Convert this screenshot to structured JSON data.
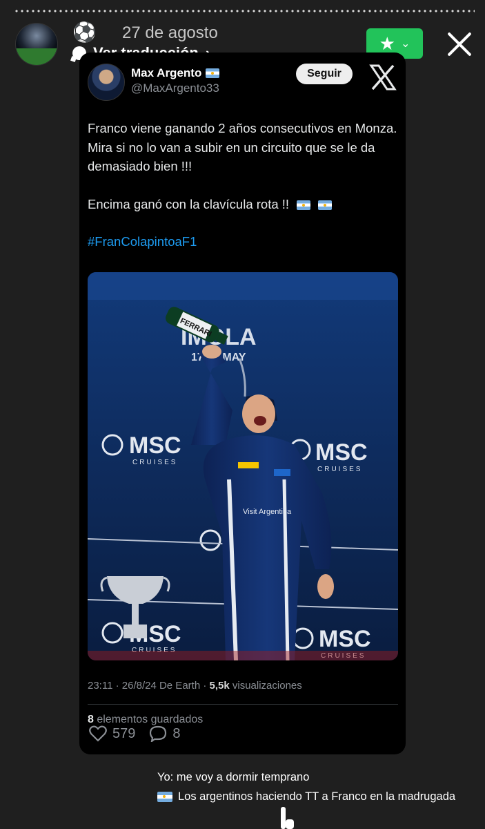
{
  "story": {
    "date": "27 de agosto",
    "ball_emoji": "⚽",
    "translate_label": "Ver traducción",
    "translate_chevron": "›",
    "favorite_star": "★",
    "favorite_caret": "⌄"
  },
  "tweet": {
    "name": "Max Argento",
    "handle": "@MaxArgento33",
    "follow_label": "Seguir",
    "text_line1": "Franco viene ganando 2 años consecutivos en Monza. Mira si no lo van a subir en un circuito que se le da demasiado bien !!!",
    "text_line2": "Encima ganó con la clavícula rota !!",
    "hashtag": "#FranColapintoaF1",
    "time_date": "23:11 · 26/8/24 De Earth · ",
    "views_count": "5,5k",
    "views_label": " visualizaciones",
    "saved_count": "8",
    "saved_label": " elementos guardados",
    "likes": "579",
    "replies": "8"
  },
  "photo": {
    "banner_text": "IMOLA",
    "banner_date": "17-19 MAY",
    "sponsor": "MSC",
    "sponsor_sub": "CRUISES",
    "bottle_label": "FERRARI",
    "suit_text": "Visit Argentina"
  },
  "caption": {
    "line1": "Yo: me voy a  dormir temprano",
    "line2": "Los argentinos haciendo TT a Franco en la madrugada"
  },
  "colors": {
    "background": "#1f1f1f",
    "card": "#000000",
    "accent_green": "#22c35a",
    "hashtag_blue": "#1d9bf0"
  }
}
